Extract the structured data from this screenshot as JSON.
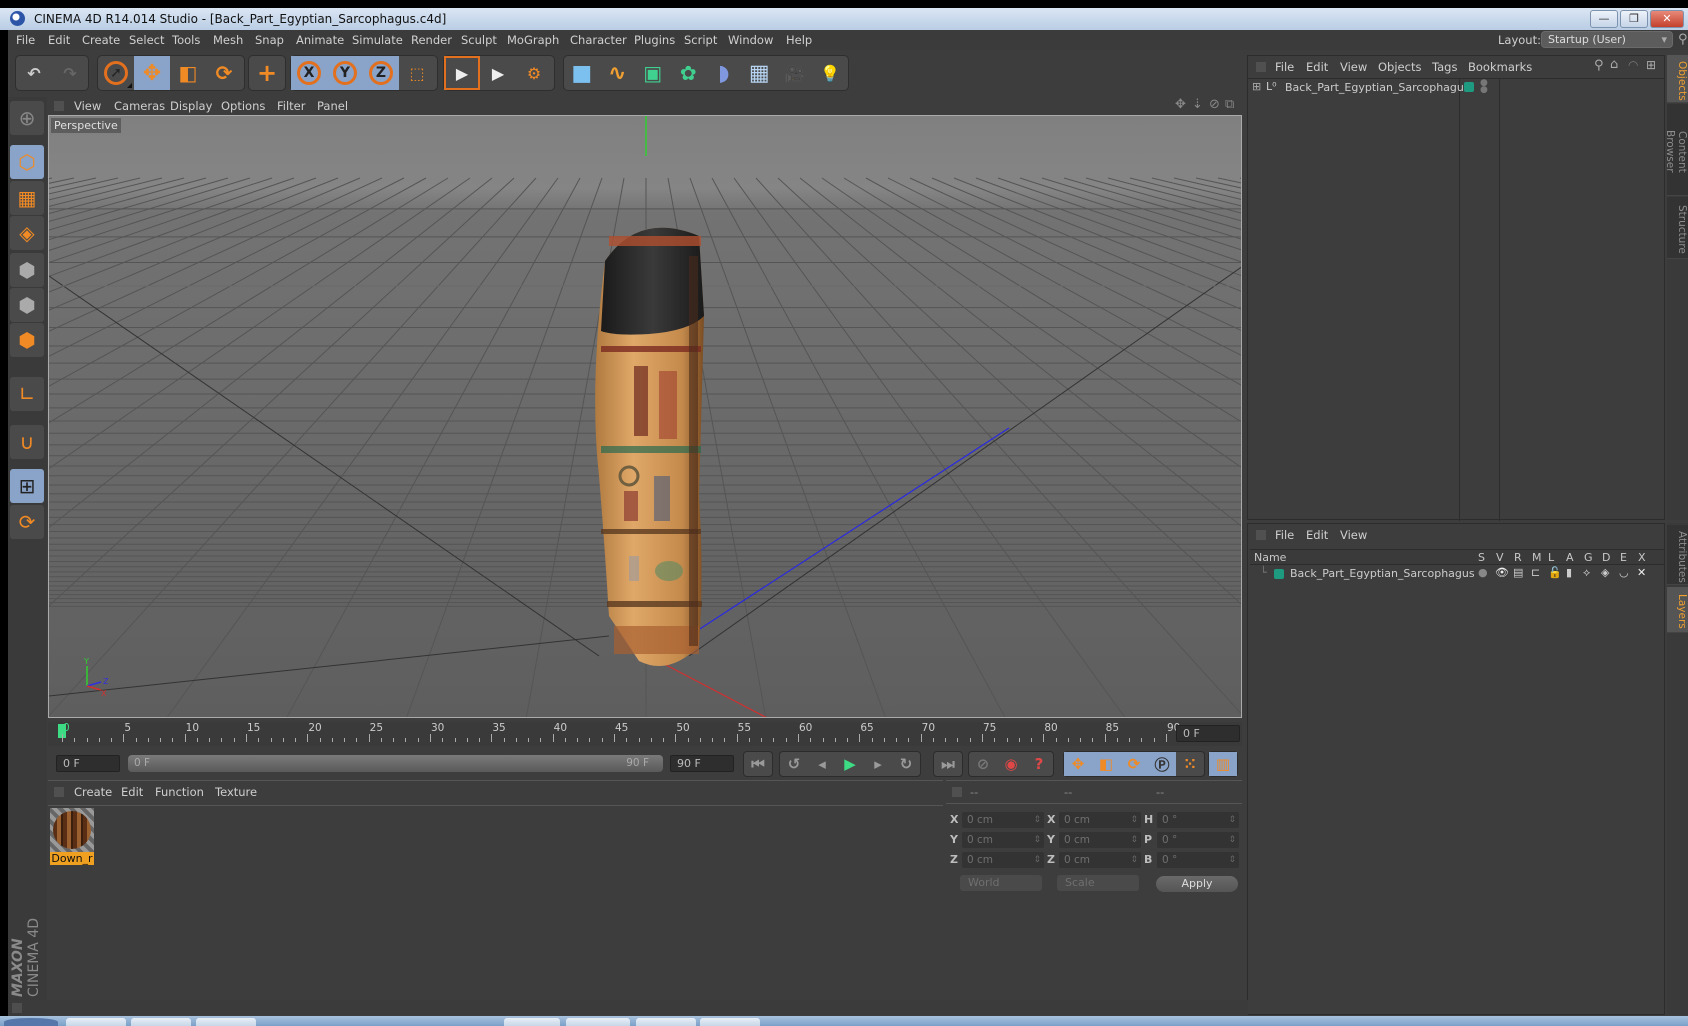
{
  "window": {
    "title": "CINEMA 4D R14.014 Studio - [Back_Part_Egyptian_Sarcophagus.c4d]",
    "minimize_label": "—",
    "restore_label": "❐",
    "close_label": "✕"
  },
  "menubar": {
    "items": [
      "File",
      "Edit",
      "Create",
      "Select",
      "Tools",
      "Mesh",
      "Snap",
      "Animate",
      "Simulate",
      "Render",
      "Sculpt",
      "MoGraph",
      "Character",
      "Plugins",
      "Script",
      "Window",
      "Help"
    ],
    "layout_label": "Layout:",
    "layout_value": "Startup (User)"
  },
  "toolbar": {
    "undo_icon": "↶",
    "redo_icon": "↷",
    "live_select_icon": "➚",
    "move_icon": "✥",
    "scale_icon": "◧",
    "rotate_icon": "⟳",
    "add_icon": "+",
    "x_label": "X",
    "y_label": "Y",
    "z_label": "Z",
    "coord_system_icon": "⬚",
    "render_view_icon": "▶",
    "render_picture_viewer_icon": "▶",
    "render_settings_icon": "⚙",
    "cube_icon": "■",
    "spline_icon": "∿",
    "subdiv_icon": "▣",
    "cloner_icon": "✿",
    "deformer_icon": "◗",
    "floor_icon": "▦",
    "camera_icon": "🎥",
    "light_icon": "💡"
  },
  "viewport": {
    "menu": [
      "View",
      "Cameras",
      "Display",
      "Options",
      "Filter",
      "Panel"
    ],
    "camera_label": "Perspective",
    "axis_labels": {
      "x": "X",
      "y": "Y",
      "z": "Z"
    }
  },
  "timeline": {
    "ticks": [
      "0",
      "5",
      "10",
      "15",
      "20",
      "25",
      "30",
      "35",
      "40",
      "45",
      "50",
      "55",
      "60",
      "65",
      "70",
      "75",
      "80",
      "85",
      "90"
    ],
    "current_frame_display": "0 F",
    "start_frame": "0 F",
    "range_start": "0 F",
    "range_end": "90 F",
    "end_frame": "90 F"
  },
  "material_manager": {
    "menu": [
      "Create",
      "Edit",
      "Function",
      "Texture"
    ],
    "materials": [
      {
        "name": "Down_r",
        "selected": true
      }
    ]
  },
  "coordinates": {
    "headers": [
      "--",
      "--",
      "--"
    ],
    "rows": [
      {
        "label1": "X",
        "pos": "0 cm",
        "label2": "X",
        "size": "0 cm",
        "label3": "H",
        "rot": "0 °"
      },
      {
        "label1": "Y",
        "pos": "0 cm",
        "label2": "Y",
        "size": "0 cm",
        "label3": "P",
        "rot": "0 °"
      },
      {
        "label1": "Z",
        "pos": "0 cm",
        "label2": "Z",
        "size": "0 cm",
        "label3": "B",
        "rot": "0 °"
      }
    ],
    "space_select": "World",
    "mode_select": "Scale",
    "apply_label": "Apply"
  },
  "object_manager": {
    "menu": [
      "File",
      "Edit",
      "View",
      "Objects",
      "Tags",
      "Bookmarks"
    ],
    "objects": [
      {
        "name": "Back_Part_Egyptian_Sarcophagus",
        "layer_color": "#1e9a80"
      }
    ]
  },
  "layer_manager": {
    "menu": [
      "File",
      "Edit",
      "View"
    ],
    "columns": [
      "Name",
      "S",
      "V",
      "R",
      "M",
      "L",
      "A",
      "G",
      "D",
      "E",
      "X"
    ],
    "layers": [
      {
        "name": "Back_Part_Egyptian_Sarcophagus",
        "color": "#1e9a80"
      }
    ]
  },
  "side_tabs": {
    "top": [
      "Objects",
      "Content Browser",
      "Structure"
    ],
    "bottom": [
      "Attributes",
      "Layers"
    ]
  },
  "branding": {
    "maxon": "MAXON",
    "product": "CINEMA 4D"
  },
  "colors": {
    "accent": "#f08a24",
    "selected": "#8aa3c8",
    "playhead": "#3ddc84",
    "object_layer": "#1e9a80",
    "material_selected": "#f0a020"
  }
}
